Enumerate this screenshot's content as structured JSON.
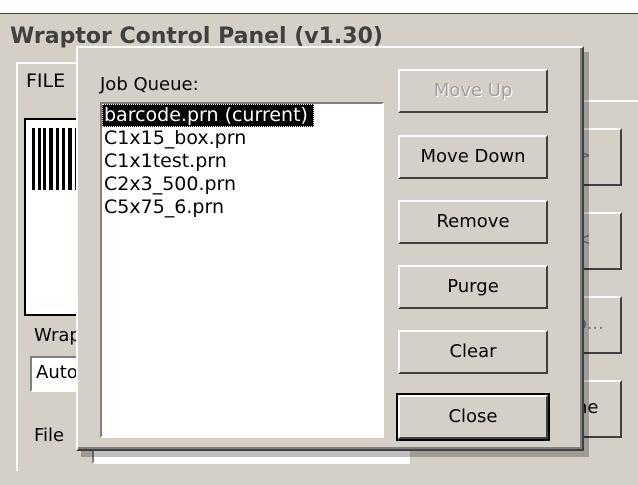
{
  "main_window": {
    "title": "Wraptor Control Panel (v1.30)",
    "tab_file": "FILE",
    "label_wrap": "Wrap",
    "dropdown_value": "Auto",
    "label_file": "File",
    "side_buttons": [
      ">",
      "<",
      "o...",
      "ne"
    ]
  },
  "dialog": {
    "list_label": "Job Queue:",
    "jobs": [
      "barcode.prn (current)",
      "C1x15_box.prn",
      "C1x1test.prn",
      "C2x3_500.prn",
      "C5x75_6.prn"
    ],
    "selected_index": 0,
    "buttons": {
      "move_up": "Move Up",
      "move_down": "Move Down",
      "remove": "Remove",
      "purge": "Purge",
      "clear": "Clear",
      "close": "Close"
    }
  },
  "colors": {
    "face": "#d4d0c8",
    "selection_bg": "#000000",
    "disabled_text": "#a0a0a0"
  }
}
